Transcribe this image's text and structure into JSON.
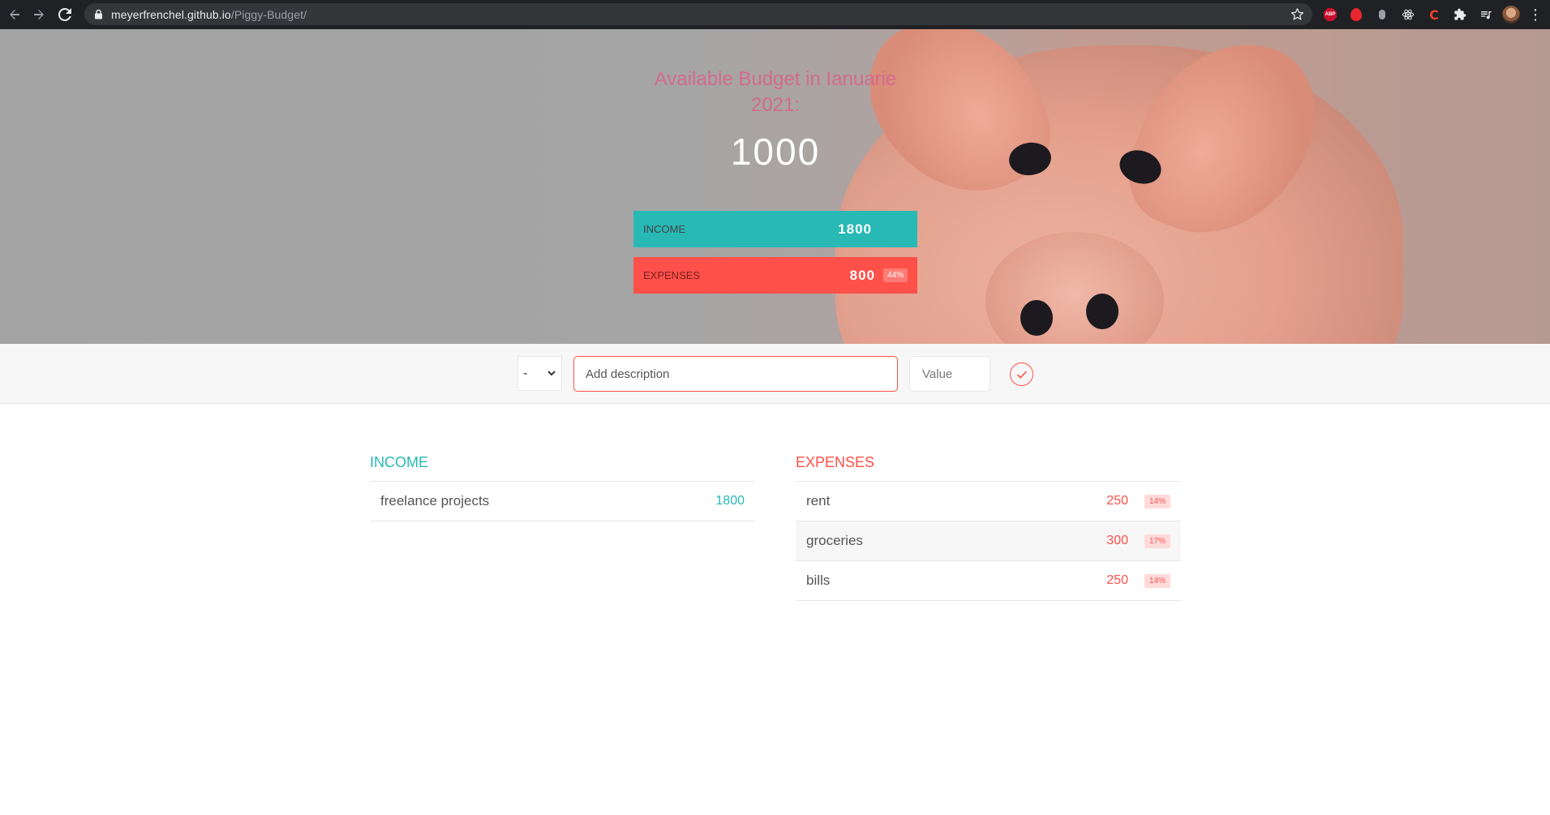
{
  "browser": {
    "url_host": "meyerfrenchel.github.io",
    "url_path": "/Piggy-Budget/",
    "icons": [
      "back-icon",
      "forward-icon",
      "reload-icon",
      "lock-icon",
      "star-icon",
      "adblock-icon",
      "extension-icon",
      "extension-icon",
      "react-icon",
      "extension-icon",
      "puzzle-icon",
      "media-icon",
      "avatar",
      "kebab-menu-icon"
    ],
    "abp_label": "ABP",
    "ext_c_label": "C",
    "kebab": "⋮"
  },
  "budget": {
    "title": "Available Budget in Ianuarie 2021:",
    "value": "1000"
  },
  "summary": {
    "income_label": "Income",
    "income_value": "1800",
    "expenses_label": "Expenses",
    "expenses_value": "800",
    "expenses_percentage": "44%"
  },
  "add_form": {
    "type_selected": "-",
    "description_placeholder": "Add description",
    "value_placeholder": "Value"
  },
  "income": {
    "title": "Income",
    "items": [
      {
        "description": "freelance projects",
        "value": "1800"
      }
    ]
  },
  "expenses": {
    "title": "Expenses",
    "items": [
      {
        "description": "rent",
        "value": "250",
        "percentage": "14%"
      },
      {
        "description": "groceries",
        "value": "300",
        "percentage": "17%"
      },
      {
        "description": "bills",
        "value": "250",
        "percentage": "14%"
      }
    ]
  },
  "colors": {
    "income": "#28b9b5",
    "expenses": "#ff5049",
    "title_pink": "#d46a8e"
  }
}
